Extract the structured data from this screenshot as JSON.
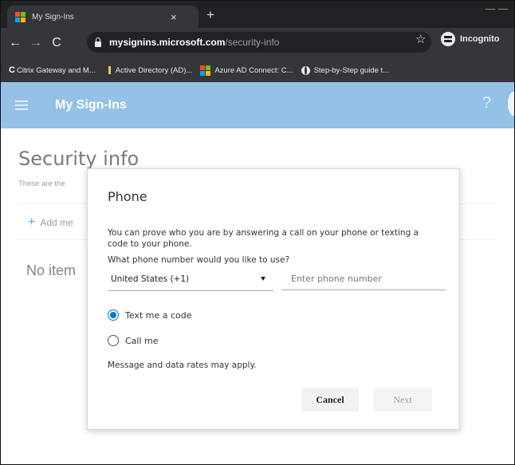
{
  "browser": {
    "tab_title": "My Sign-Ins",
    "tab_close": "×",
    "new_tab": "+",
    "url_host": "mysignins.microsoft.com",
    "url_path": "/security-info",
    "incognito_label": "Incognito",
    "ms_logo_colors": [
      "#f25022",
      "#7fba00",
      "#00a4ef",
      "#ffb900"
    ],
    "nav_icons": [
      "back-icon",
      "forward-icon",
      "reload-icon"
    ],
    "bookmarks": [
      {
        "label": "Citrix Gateway and M...",
        "icon": "citrix-icon"
      },
      {
        "label": "Active Directory (AD)...",
        "icon": "folder-icon"
      },
      {
        "label": "Azure AD Connect: C...",
        "icon": "microsoft-icon"
      },
      {
        "label": "Step-by-Step guide t...",
        "icon": "globe-icon"
      }
    ]
  },
  "app": {
    "title": "My Sign-Ins",
    "help": "?",
    "header_color": "#5da0db"
  },
  "page": {
    "title": "Security info",
    "subtitle": "These are the",
    "add_method": "Add me",
    "add_plus": "+",
    "no_items": "No item"
  },
  "dialog": {
    "title": "Phone",
    "description": "You can prove who you are by answering a call on your phone or texting a code to your phone.",
    "question": "What phone number would you like to use?",
    "country_selected": "United States (+1)",
    "phone_placeholder": "Enter phone number",
    "phone_value": "",
    "options": [
      {
        "label": "Text me a code",
        "selected": true
      },
      {
        "label": "Call me",
        "selected": false
      }
    ],
    "rates_note": "Message and data rates may apply.",
    "cancel_label": "Cancel",
    "next_label": "Next",
    "accent": "#0078d4"
  }
}
